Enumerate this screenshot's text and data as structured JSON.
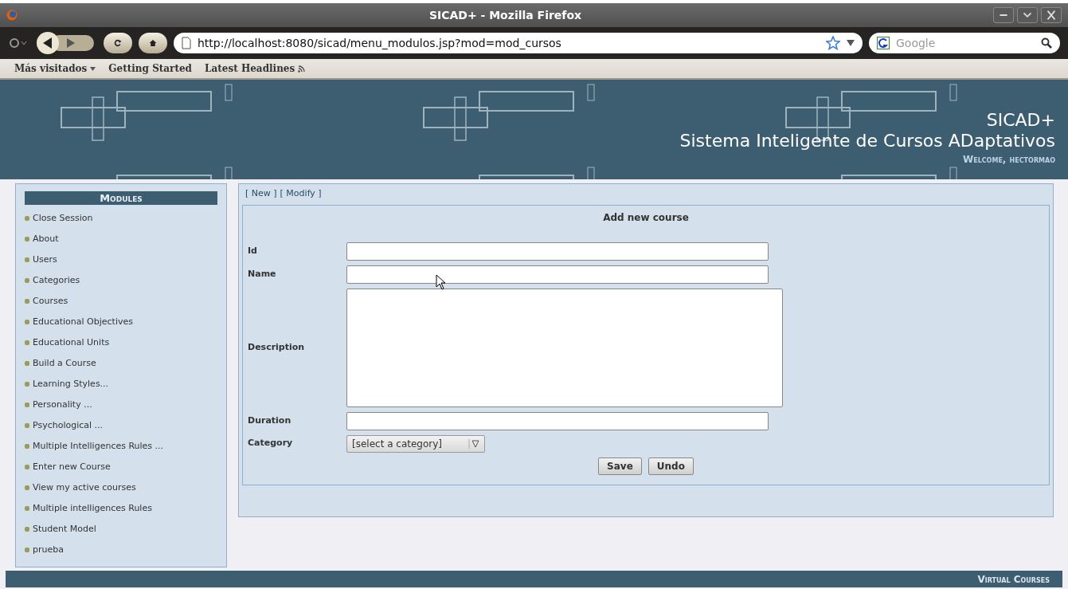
{
  "window": {
    "title": "SICAD+ - Mozilla Firefox"
  },
  "toolbar": {
    "url": "http://localhost:8080/sicad/menu_modulos.jsp?mod=mod_cursos",
    "search_placeholder": "Google"
  },
  "bookmarks": [
    {
      "label": "Más visitados",
      "kind": "menu"
    },
    {
      "label": "Getting Started",
      "kind": "link"
    },
    {
      "label": "Latest Headlines",
      "kind": "feed"
    }
  ],
  "header": {
    "title": "SICAD+",
    "subtitle": "Sistema Inteligente de Cursos ADaptativos",
    "welcome": "Welcome, hectormao"
  },
  "sidebar": {
    "title": "Modules",
    "items": [
      "Close Session",
      "About",
      "Users",
      "Categories",
      "Courses",
      "Educational Objectives",
      "Educational Units",
      "Build a Course",
      "Learning Styles...",
      "Personality ...",
      "Psychological ...",
      "Multiple Intelligences Rules ...",
      "Enter new Course",
      "View my active courses",
      "Multiple intelligences Rules",
      "Student Model",
      "prueba"
    ]
  },
  "actions": [
    "[ New ]",
    "[ Modify ]"
  ],
  "form": {
    "title": "Add new course",
    "fields": [
      {
        "label": "Id",
        "kind": "text"
      },
      {
        "label": "Name",
        "kind": "text"
      },
      {
        "label": "Description",
        "kind": "textarea"
      },
      {
        "label": "Duration",
        "kind": "text"
      },
      {
        "label": "Category",
        "kind": "select",
        "value": "[select a category]"
      }
    ],
    "buttons": [
      "Save",
      "Undo"
    ]
  },
  "footer": "Virtual Courses"
}
